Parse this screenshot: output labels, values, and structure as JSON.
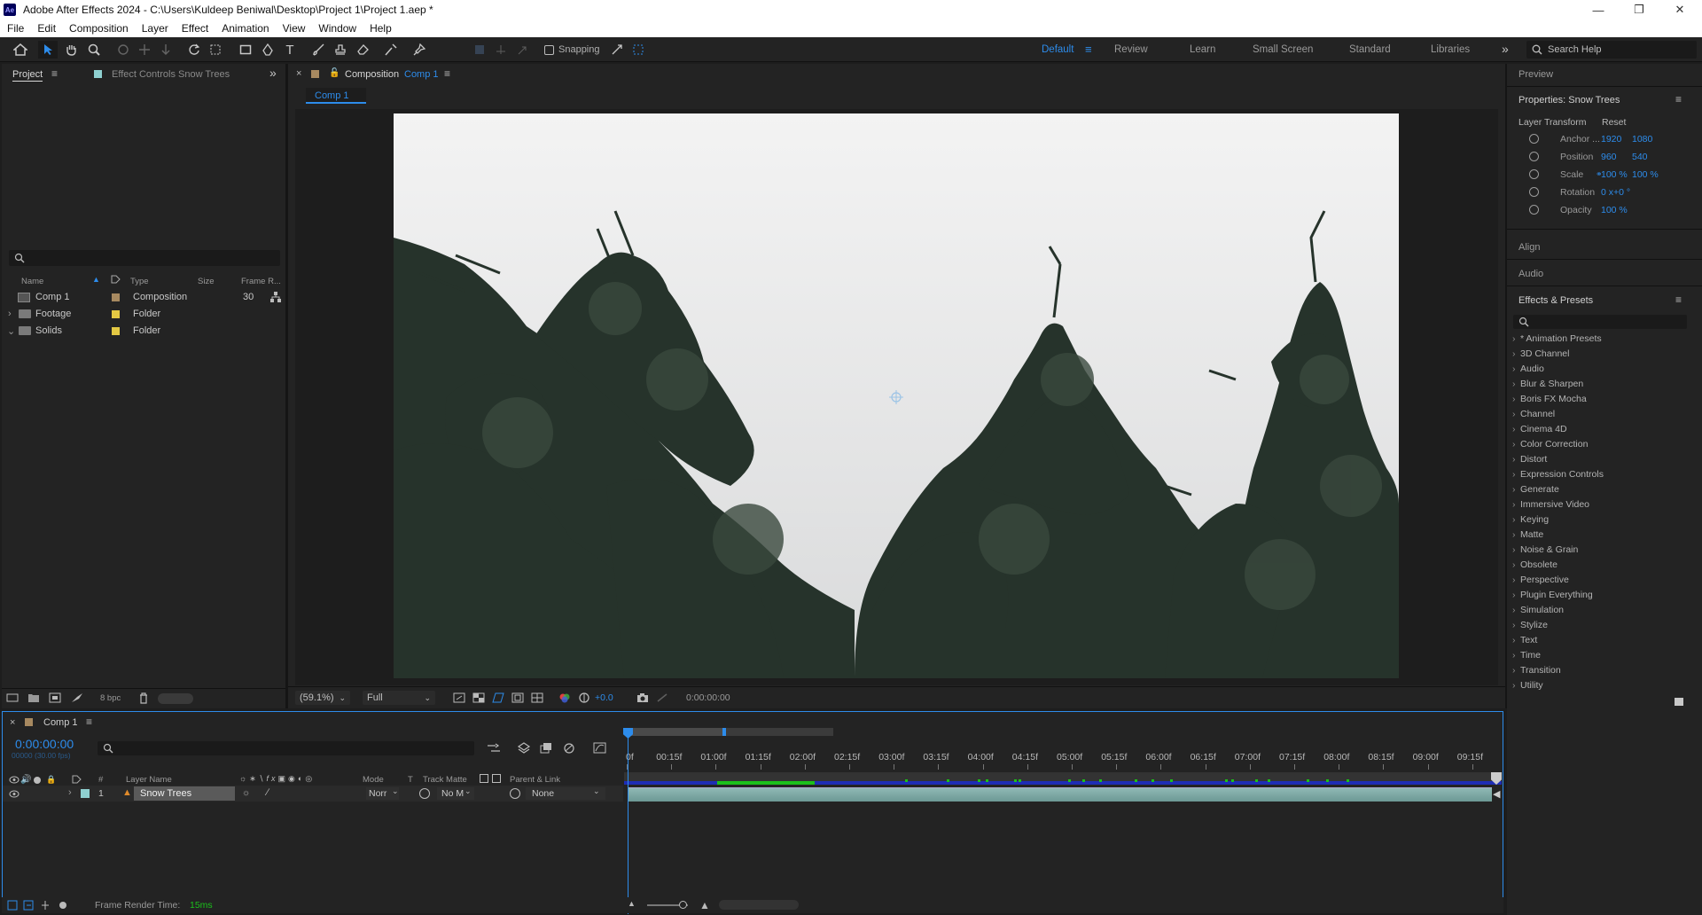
{
  "window": {
    "title": "Adobe After Effects 2024 - C:\\Users\\Kuldeep Beniwal\\Desktop\\Project 1\\Project 1.aep *",
    "app_icon": "Ae"
  },
  "menu": [
    "File",
    "Edit",
    "Composition",
    "Layer",
    "Effect",
    "Animation",
    "View",
    "Window",
    "Help"
  ],
  "toolbar": {
    "snapping": "Snapping",
    "workspaces": [
      "Default",
      "Review",
      "Learn",
      "Small Screen",
      "Standard",
      "Libraries"
    ],
    "active_workspace": "Default",
    "search_help": "Search Help",
    "icons": [
      "home-icon",
      "selection-tool-icon",
      "hand-tool-icon",
      "zoom-tool-icon",
      "orbit-camera-icon",
      "pan-camera-icon",
      "dolly-camera-icon",
      "rotation-tool-icon",
      "pan-behind-icon",
      "rectangle-tool-icon",
      "pen-tool-icon",
      "type-tool-icon",
      "brush-tool-icon",
      "clone-stamp-icon",
      "eraser-tool-icon",
      "roto-brush-icon",
      "puppet-pin-icon"
    ]
  },
  "project": {
    "tab_project": "Project",
    "tab_effect_controls": "Effect Controls Snow Trees",
    "columns": [
      "Name",
      "Type",
      "Size",
      "Frame R..."
    ],
    "items": [
      {
        "name": "Comp 1",
        "type": "Composition",
        "size": "",
        "frame_rate": "30",
        "color": "#a78960"
      },
      {
        "name": "Footage",
        "type": "Folder",
        "size": "",
        "frame_rate": "",
        "color": "#e3c843"
      },
      {
        "name": "Solids",
        "type": "Folder",
        "size": "",
        "frame_rate": "",
        "color": "#e3c843"
      }
    ],
    "bpc": "8 bpc"
  },
  "composition": {
    "panel_label": "Composition",
    "comp_name": "Comp 1",
    "tab_label": "Comp 1",
    "zoom": "(59.1%)",
    "resolution": "Full",
    "exposure": "+0.0",
    "timecode": "0:00:00:00"
  },
  "right": {
    "preview": "Preview",
    "properties_title": "Properties: Snow Trees",
    "layer_transform": "Layer Transform",
    "reset": "Reset",
    "props": [
      {
        "name": "Anchor ...",
        "v1": "1920",
        "v2": "1080"
      },
      {
        "name": "Position",
        "v1": "960",
        "v2": "540"
      },
      {
        "name": "Scale",
        "v1": "100 %",
        "v2": "100 %"
      },
      {
        "name": "Rotation",
        "v1": "0 x+0 °",
        "v2": ""
      },
      {
        "name": "Opacity",
        "v1": "100 %",
        "v2": ""
      }
    ],
    "align": "Align",
    "audio": "Audio",
    "effects_presets": "Effects & Presets",
    "effects": [
      "* Animation Presets",
      "3D Channel",
      "Audio",
      "Blur & Sharpen",
      "Boris FX Mocha",
      "Channel",
      "Cinema 4D",
      "Color Correction",
      "Distort",
      "Expression Controls",
      "Generate",
      "Immersive Video",
      "Keying",
      "Matte",
      "Noise & Grain",
      "Obsolete",
      "Perspective",
      "Plugin Everything",
      "Simulation",
      "Stylize",
      "Text",
      "Time",
      "Transition",
      "Utility"
    ]
  },
  "timeline": {
    "tab": "Comp 1",
    "timecode": "0:00:00:00",
    "fps": "00000 (30.00 fps)",
    "headers": {
      "num": "#",
      "layer_name": "Layer Name",
      "mode": "Mode",
      "t": "T",
      "track_matte": "Track Matte",
      "parent": "Parent & Link"
    },
    "layer": {
      "index": "1",
      "name": "Snow Trees",
      "mode": "Norr",
      "matte": "No M",
      "parent": "None",
      "label_color": "#8fd0d0"
    },
    "ruler": [
      "0f",
      "00:15f",
      "01:00f",
      "01:15f",
      "02:00f",
      "02:15f",
      "03:00f",
      "03:15f",
      "04:00f",
      "04:15f",
      "05:00f",
      "05:15f",
      "06:00f",
      "06:15f",
      "07:00f",
      "07:15f",
      "08:00f",
      "08:15f",
      "09:00f",
      "09:15f"
    ],
    "render_label": "Frame Render Time:",
    "render_value": "15ms"
  }
}
